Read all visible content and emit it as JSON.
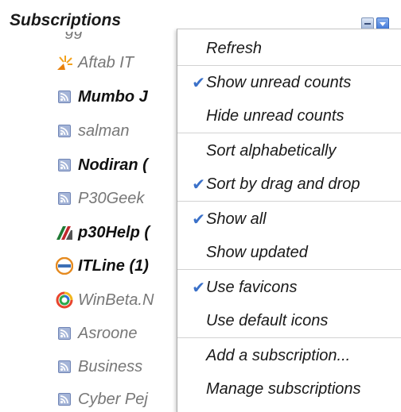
{
  "header": {
    "title": "Subscriptions"
  },
  "subscriptions": [
    {
      "label": "Aftab IT",
      "icon": "aftab-favicon",
      "unread": false
    },
    {
      "label": "Mumbo J",
      "icon": "rss-feed-icon",
      "unread": true
    },
    {
      "label": "salman",
      "icon": "rss-feed-icon",
      "unread": false
    },
    {
      "label": "Nodiran (",
      "icon": "rss-feed-icon",
      "unread": true
    },
    {
      "label": "P30Geek",
      "icon": "rss-feed-icon",
      "unread": false
    },
    {
      "label": "p30Help (",
      "icon": "p30help-favicon",
      "unread": true
    },
    {
      "label": "ITLine (1)",
      "icon": "itline-favicon",
      "unread": true
    },
    {
      "label": "WinBeta.N",
      "icon": "winbeta-favicon",
      "unread": false
    },
    {
      "label": "Asroone",
      "icon": "rss-feed-icon",
      "unread": false
    },
    {
      "label": "Business",
      "icon": "rss-feed-icon",
      "unread": false
    },
    {
      "label": "Cyber Pej",
      "icon": "rss-feed-icon",
      "unread": false
    }
  ],
  "menu": {
    "items": [
      {
        "label": "Refresh",
        "checked": false
      },
      {
        "label": "Show unread counts",
        "checked": true
      },
      {
        "label": "Hide unread counts",
        "checked": false
      },
      {
        "label": "Sort alphabetically",
        "checked": false
      },
      {
        "label": "Sort by drag and drop",
        "checked": true
      },
      {
        "label": "Show all",
        "checked": true
      },
      {
        "label": "Show updated",
        "checked": false
      },
      {
        "label": "Use favicons",
        "checked": true
      },
      {
        "label": "Use default icons",
        "checked": false
      },
      {
        "label": "Add a subscription...",
        "checked": false
      },
      {
        "label": "Manage subscriptions",
        "checked": false
      }
    ]
  },
  "colors": {
    "accent": "#3b71c9",
    "rss_icon": "#6f84b5"
  }
}
